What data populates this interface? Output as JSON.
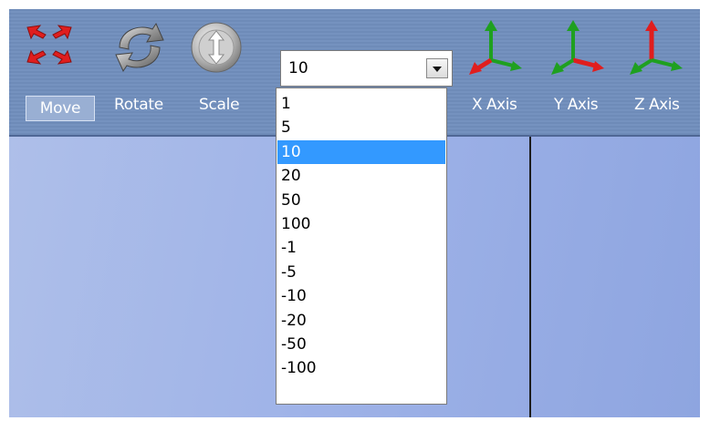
{
  "toolbar": {
    "move_label": "Move",
    "rotate_label": "Rotate",
    "scale_label": "Scale",
    "x_axis_label": "X Axis",
    "y_axis_label": "Y Axis",
    "z_axis_label": "Z Axis"
  },
  "step_select": {
    "value": "10",
    "selected_index": 2,
    "options": [
      "1",
      "5",
      "10",
      "20",
      "50",
      "100",
      "-1",
      "-5",
      "-10",
      "-20",
      "-50",
      "-100"
    ]
  },
  "colors": {
    "toolbar_bg": "#7592bf",
    "viewport_bg": "#9fb3e8",
    "selection": "#3399ff",
    "axis_red": "#e01e1e",
    "axis_green": "#1fa020"
  },
  "icons": {
    "move": "move-arrows-icon",
    "rotate": "rotate-icon",
    "scale": "scale-icon",
    "x_axis": "x-axis-icon",
    "y_axis": "y-axis-icon",
    "z_axis": "z-axis-icon"
  }
}
